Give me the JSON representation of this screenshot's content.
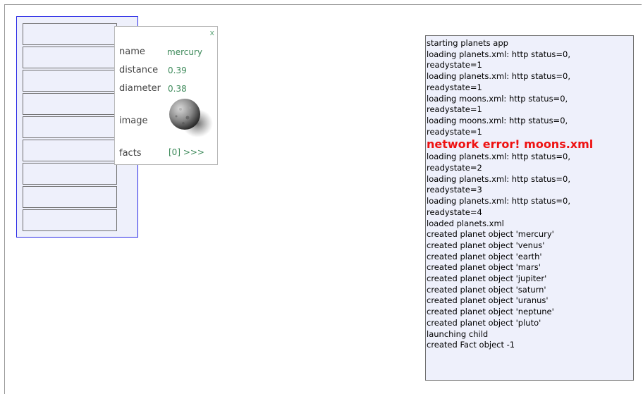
{
  "planet_list": {
    "rows": [
      "",
      "",
      "",
      "",
      "",
      "",
      "",
      "",
      ""
    ]
  },
  "detail": {
    "close_label": "x",
    "name_label": "name",
    "name_value": "mercury",
    "distance_label": "distance",
    "distance_value": "0.39",
    "diameter_label": "diameter",
    "diameter_value": "0.38",
    "image_label": "image",
    "facts_label": "facts",
    "facts_value": "[0] >>>"
  },
  "log": {
    "lines": [
      {
        "text": "starting planets app",
        "type": "normal"
      },
      {
        "text": "loading planets.xml: http status=0, readystate=1",
        "type": "normal"
      },
      {
        "text": "loading planets.xml: http status=0, readystate=1",
        "type": "normal"
      },
      {
        "text": "loading moons.xml: http status=0, readystate=1",
        "type": "normal"
      },
      {
        "text": "loading moons.xml: http status=0, readystate=1",
        "type": "normal"
      },
      {
        "text": "network error! moons.xml",
        "type": "error"
      },
      {
        "text": "loading planets.xml: http status=0, readystate=2",
        "type": "normal"
      },
      {
        "text": "loading planets.xml: http status=0, readystate=3",
        "type": "normal"
      },
      {
        "text": "loading planets.xml: http status=0, readystate=4",
        "type": "normal"
      },
      {
        "text": "loaded planets.xml",
        "type": "normal"
      },
      {
        "text": "created planet object 'mercury'",
        "type": "normal"
      },
      {
        "text": "created planet object 'venus'",
        "type": "normal"
      },
      {
        "text": "created planet object 'earth'",
        "type": "normal"
      },
      {
        "text": "created planet object 'mars'",
        "type": "normal"
      },
      {
        "text": "created planet object 'jupiter'",
        "type": "normal"
      },
      {
        "text": "created planet object 'saturn'",
        "type": "normal"
      },
      {
        "text": "created planet object 'uranus'",
        "type": "normal"
      },
      {
        "text": "created planet object 'neptune'",
        "type": "normal"
      },
      {
        "text": "created planet object 'pluto'",
        "type": "normal"
      },
      {
        "text": "launching child",
        "type": "normal"
      },
      {
        "text": "created Fact object -1",
        "type": "normal"
      }
    ]
  },
  "colors": {
    "panel_border": "#2a2ae6",
    "panel_bg": "#eef0fb",
    "value_text": "#3d8a5a",
    "error_text": "#ee1111"
  },
  "icons": {
    "planet_image": "mercury-planet-image"
  }
}
